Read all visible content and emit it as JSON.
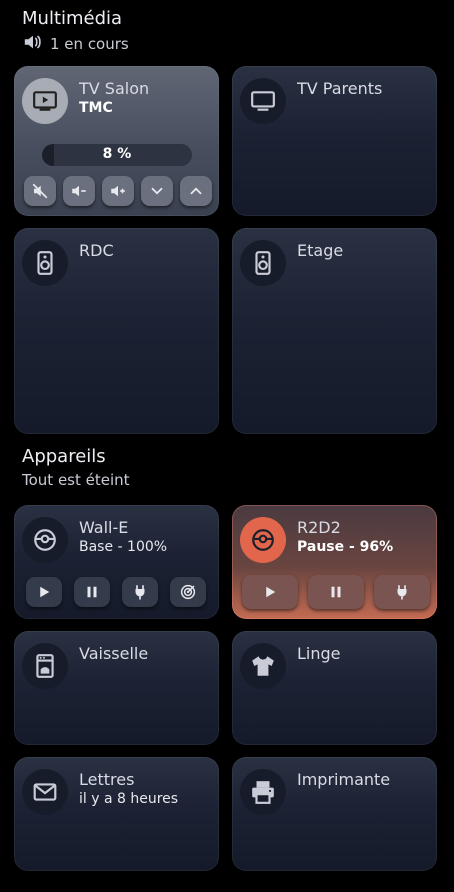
{
  "multimedia": {
    "title": "Multimédia",
    "status": "1 en cours",
    "cards": [
      {
        "title": "TV Salon",
        "subtitle": "TMC",
        "progress_label": "8 %",
        "progress": 0.08,
        "icon": "tv-play-icon"
      },
      {
        "title": "TV Parents",
        "icon": "tv-icon"
      },
      {
        "title": "RDC",
        "icon": "speaker-icon"
      },
      {
        "title": "Etage",
        "icon": "speaker-icon"
      }
    ]
  },
  "appareils": {
    "title": "Appareils",
    "status": "Tout est éteint",
    "cards": [
      {
        "title": "Wall-E",
        "subtitle": "Base - 100%",
        "icon": "robot-vacuum-icon"
      },
      {
        "title": "R2D2",
        "subtitle": "Pause - 96%",
        "icon": "robot-vacuum-icon"
      },
      {
        "title": "Vaisselle",
        "icon": "dishwasher-icon"
      },
      {
        "title": "Linge",
        "icon": "tshirt-icon"
      },
      {
        "title": "Lettres",
        "subtitle": "il y a 8 heures",
        "icon": "mail-icon"
      },
      {
        "title": "Imprimante",
        "icon": "printer-icon"
      }
    ]
  },
  "colors": {
    "alert": "#e1664c",
    "background": "#000000"
  }
}
